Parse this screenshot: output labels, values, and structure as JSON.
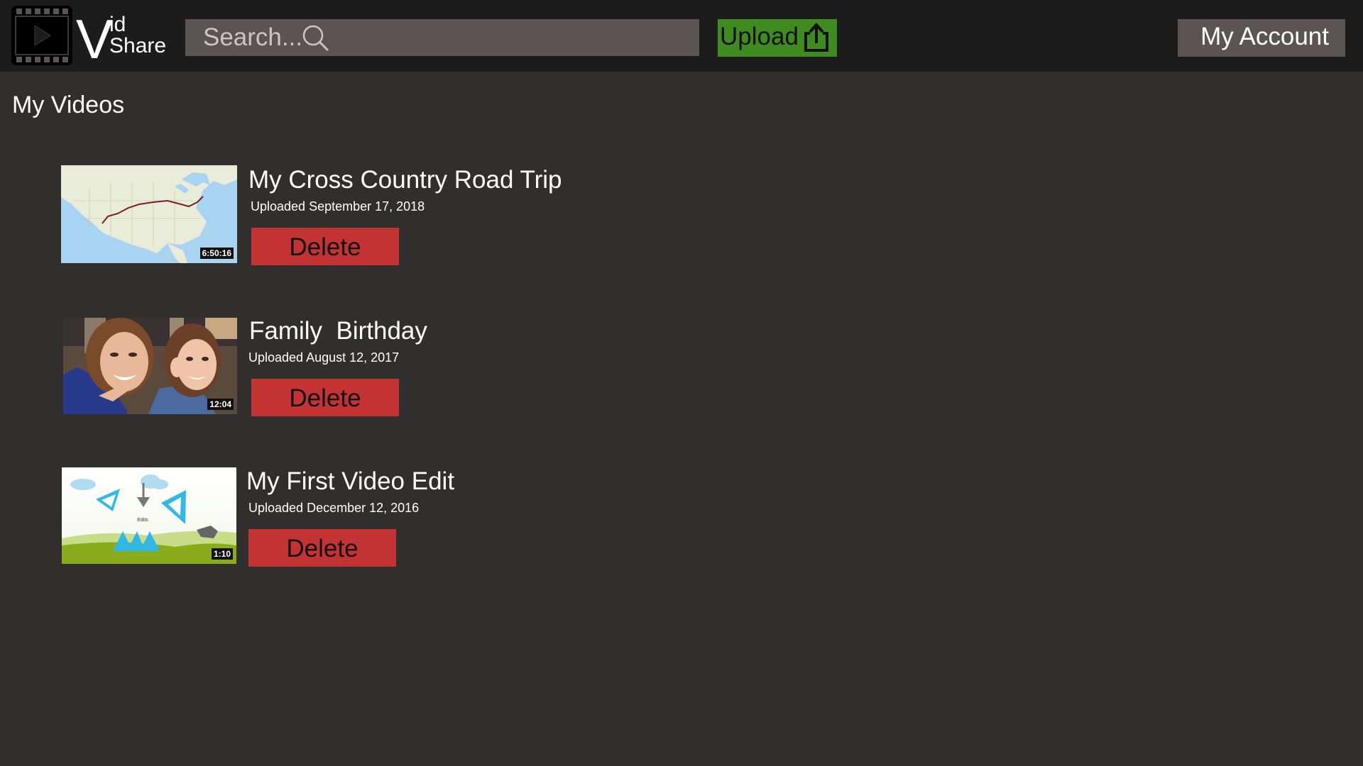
{
  "app": {
    "logo_v": "V",
    "logo_id": "id",
    "logo_share": "Share"
  },
  "header": {
    "search_placeholder": "Search...",
    "upload_label": "Upload",
    "account_label": "My Account",
    "colors": {
      "topbar": "#1d1c1c",
      "search_bg": "#5a5553",
      "upload_bg": "#3f8b20",
      "account_bg": "#5a5553"
    }
  },
  "main": {
    "title": "My Videos",
    "delete_color": "#c43334",
    "videos": [
      {
        "title": "My Cross Country Road Trip",
        "date": "Uploaded September 17, 2018",
        "duration": "6:50:16",
        "delete_label": "Delete",
        "thumbnail": "map-thumbnail"
      },
      {
        "title": "Family  Birthday",
        "date": "Uploaded August 12, 2017",
        "duration": "12:04",
        "delete_label": "Delete",
        "thumbnail": "family-photo-thumbnail"
      },
      {
        "title": "My First Video Edit",
        "date": "Uploaded December 12, 2016",
        "duration": "1:10",
        "thumbnail_caption": "Edits",
        "delete_label": "Delete",
        "thumbnail": "animation-thumbnail"
      }
    ]
  }
}
